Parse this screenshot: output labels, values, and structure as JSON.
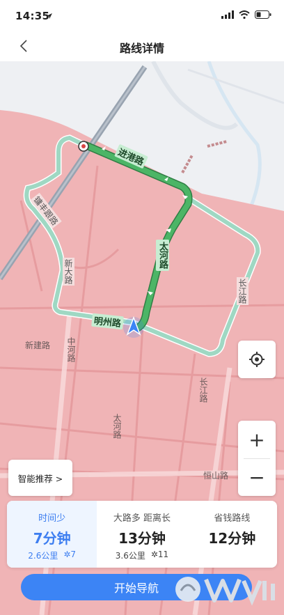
{
  "status_bar": {
    "time": "14:35"
  },
  "header": {
    "title": "路线详情"
  },
  "map": {
    "road_labels": {
      "jingang": "进港路",
      "taihe": "太河路",
      "mingzhou": "明州路",
      "xinda": "新大路",
      "yongfeng": "镛丰跟路",
      "changjiang_upper": "长江路",
      "xinjian": "新建路",
      "zhonghe": "中河路",
      "changjiang_lower": "长江路",
      "taihe_lower": "太河路",
      "hengshan": "恒山路"
    },
    "colors": {
      "district": "#f0b3b5",
      "route": "#44a55c",
      "alt_route": "#9ed8c0",
      "accent": "#3c84f5"
    }
  },
  "controls": {
    "locate_icon": "locate-icon",
    "zoom_in": "+",
    "zoom_out": "−",
    "smart_label": "智能推荐 >"
  },
  "routes": [
    {
      "tag": "时间少",
      "time": "7分钟",
      "distance": "2.6公里",
      "lights": "7",
      "selected": true
    },
    {
      "tag": "大路多  距离长",
      "time": "13分钟",
      "distance": "3.6公里",
      "lights": "11",
      "selected": false
    },
    {
      "tag": "省钱路线",
      "time": "12分钟",
      "distance": "",
      "lights": "",
      "selected": false
    }
  ],
  "start_label": "开始导航"
}
